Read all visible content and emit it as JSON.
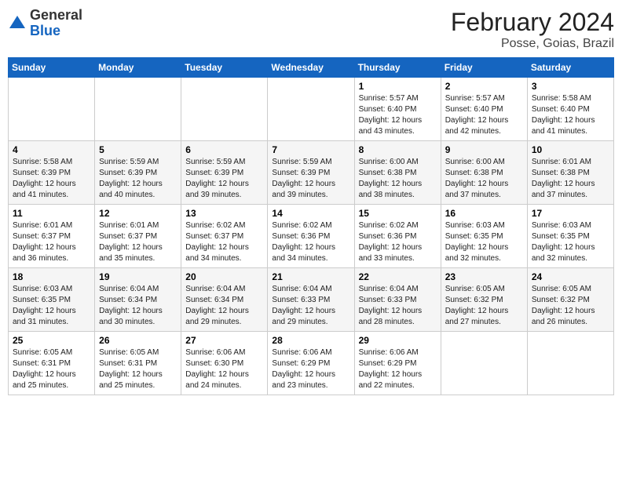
{
  "logo": {
    "general": "General",
    "blue": "Blue"
  },
  "title": {
    "month_year": "February 2024",
    "location": "Posse, Goias, Brazil"
  },
  "weekdays": [
    "Sunday",
    "Monday",
    "Tuesday",
    "Wednesday",
    "Thursday",
    "Friday",
    "Saturday"
  ],
  "weeks": [
    [
      {
        "day": "",
        "info": ""
      },
      {
        "day": "",
        "info": ""
      },
      {
        "day": "",
        "info": ""
      },
      {
        "day": "",
        "info": ""
      },
      {
        "day": "1",
        "info": "Sunrise: 5:57 AM\nSunset: 6:40 PM\nDaylight: 12 hours\nand 43 minutes."
      },
      {
        "day": "2",
        "info": "Sunrise: 5:57 AM\nSunset: 6:40 PM\nDaylight: 12 hours\nand 42 minutes."
      },
      {
        "day": "3",
        "info": "Sunrise: 5:58 AM\nSunset: 6:40 PM\nDaylight: 12 hours\nand 41 minutes."
      }
    ],
    [
      {
        "day": "4",
        "info": "Sunrise: 5:58 AM\nSunset: 6:39 PM\nDaylight: 12 hours\nand 41 minutes."
      },
      {
        "day": "5",
        "info": "Sunrise: 5:59 AM\nSunset: 6:39 PM\nDaylight: 12 hours\nand 40 minutes."
      },
      {
        "day": "6",
        "info": "Sunrise: 5:59 AM\nSunset: 6:39 PM\nDaylight: 12 hours\nand 39 minutes."
      },
      {
        "day": "7",
        "info": "Sunrise: 5:59 AM\nSunset: 6:39 PM\nDaylight: 12 hours\nand 39 minutes."
      },
      {
        "day": "8",
        "info": "Sunrise: 6:00 AM\nSunset: 6:38 PM\nDaylight: 12 hours\nand 38 minutes."
      },
      {
        "day": "9",
        "info": "Sunrise: 6:00 AM\nSunset: 6:38 PM\nDaylight: 12 hours\nand 37 minutes."
      },
      {
        "day": "10",
        "info": "Sunrise: 6:01 AM\nSunset: 6:38 PM\nDaylight: 12 hours\nand 37 minutes."
      }
    ],
    [
      {
        "day": "11",
        "info": "Sunrise: 6:01 AM\nSunset: 6:37 PM\nDaylight: 12 hours\nand 36 minutes."
      },
      {
        "day": "12",
        "info": "Sunrise: 6:01 AM\nSunset: 6:37 PM\nDaylight: 12 hours\nand 35 minutes."
      },
      {
        "day": "13",
        "info": "Sunrise: 6:02 AM\nSunset: 6:37 PM\nDaylight: 12 hours\nand 34 minutes."
      },
      {
        "day": "14",
        "info": "Sunrise: 6:02 AM\nSunset: 6:36 PM\nDaylight: 12 hours\nand 34 minutes."
      },
      {
        "day": "15",
        "info": "Sunrise: 6:02 AM\nSunset: 6:36 PM\nDaylight: 12 hours\nand 33 minutes."
      },
      {
        "day": "16",
        "info": "Sunrise: 6:03 AM\nSunset: 6:35 PM\nDaylight: 12 hours\nand 32 minutes."
      },
      {
        "day": "17",
        "info": "Sunrise: 6:03 AM\nSunset: 6:35 PM\nDaylight: 12 hours\nand 32 minutes."
      }
    ],
    [
      {
        "day": "18",
        "info": "Sunrise: 6:03 AM\nSunset: 6:35 PM\nDaylight: 12 hours\nand 31 minutes."
      },
      {
        "day": "19",
        "info": "Sunrise: 6:04 AM\nSunset: 6:34 PM\nDaylight: 12 hours\nand 30 minutes."
      },
      {
        "day": "20",
        "info": "Sunrise: 6:04 AM\nSunset: 6:34 PM\nDaylight: 12 hours\nand 29 minutes."
      },
      {
        "day": "21",
        "info": "Sunrise: 6:04 AM\nSunset: 6:33 PM\nDaylight: 12 hours\nand 29 minutes."
      },
      {
        "day": "22",
        "info": "Sunrise: 6:04 AM\nSunset: 6:33 PM\nDaylight: 12 hours\nand 28 minutes."
      },
      {
        "day": "23",
        "info": "Sunrise: 6:05 AM\nSunset: 6:32 PM\nDaylight: 12 hours\nand 27 minutes."
      },
      {
        "day": "24",
        "info": "Sunrise: 6:05 AM\nSunset: 6:32 PM\nDaylight: 12 hours\nand 26 minutes."
      }
    ],
    [
      {
        "day": "25",
        "info": "Sunrise: 6:05 AM\nSunset: 6:31 PM\nDaylight: 12 hours\nand 25 minutes."
      },
      {
        "day": "26",
        "info": "Sunrise: 6:05 AM\nSunset: 6:31 PM\nDaylight: 12 hours\nand 25 minutes."
      },
      {
        "day": "27",
        "info": "Sunrise: 6:06 AM\nSunset: 6:30 PM\nDaylight: 12 hours\nand 24 minutes."
      },
      {
        "day": "28",
        "info": "Sunrise: 6:06 AM\nSunset: 6:29 PM\nDaylight: 12 hours\nand 23 minutes."
      },
      {
        "day": "29",
        "info": "Sunrise: 6:06 AM\nSunset: 6:29 PM\nDaylight: 12 hours\nand 22 minutes."
      },
      {
        "day": "",
        "info": ""
      },
      {
        "day": "",
        "info": ""
      }
    ]
  ]
}
